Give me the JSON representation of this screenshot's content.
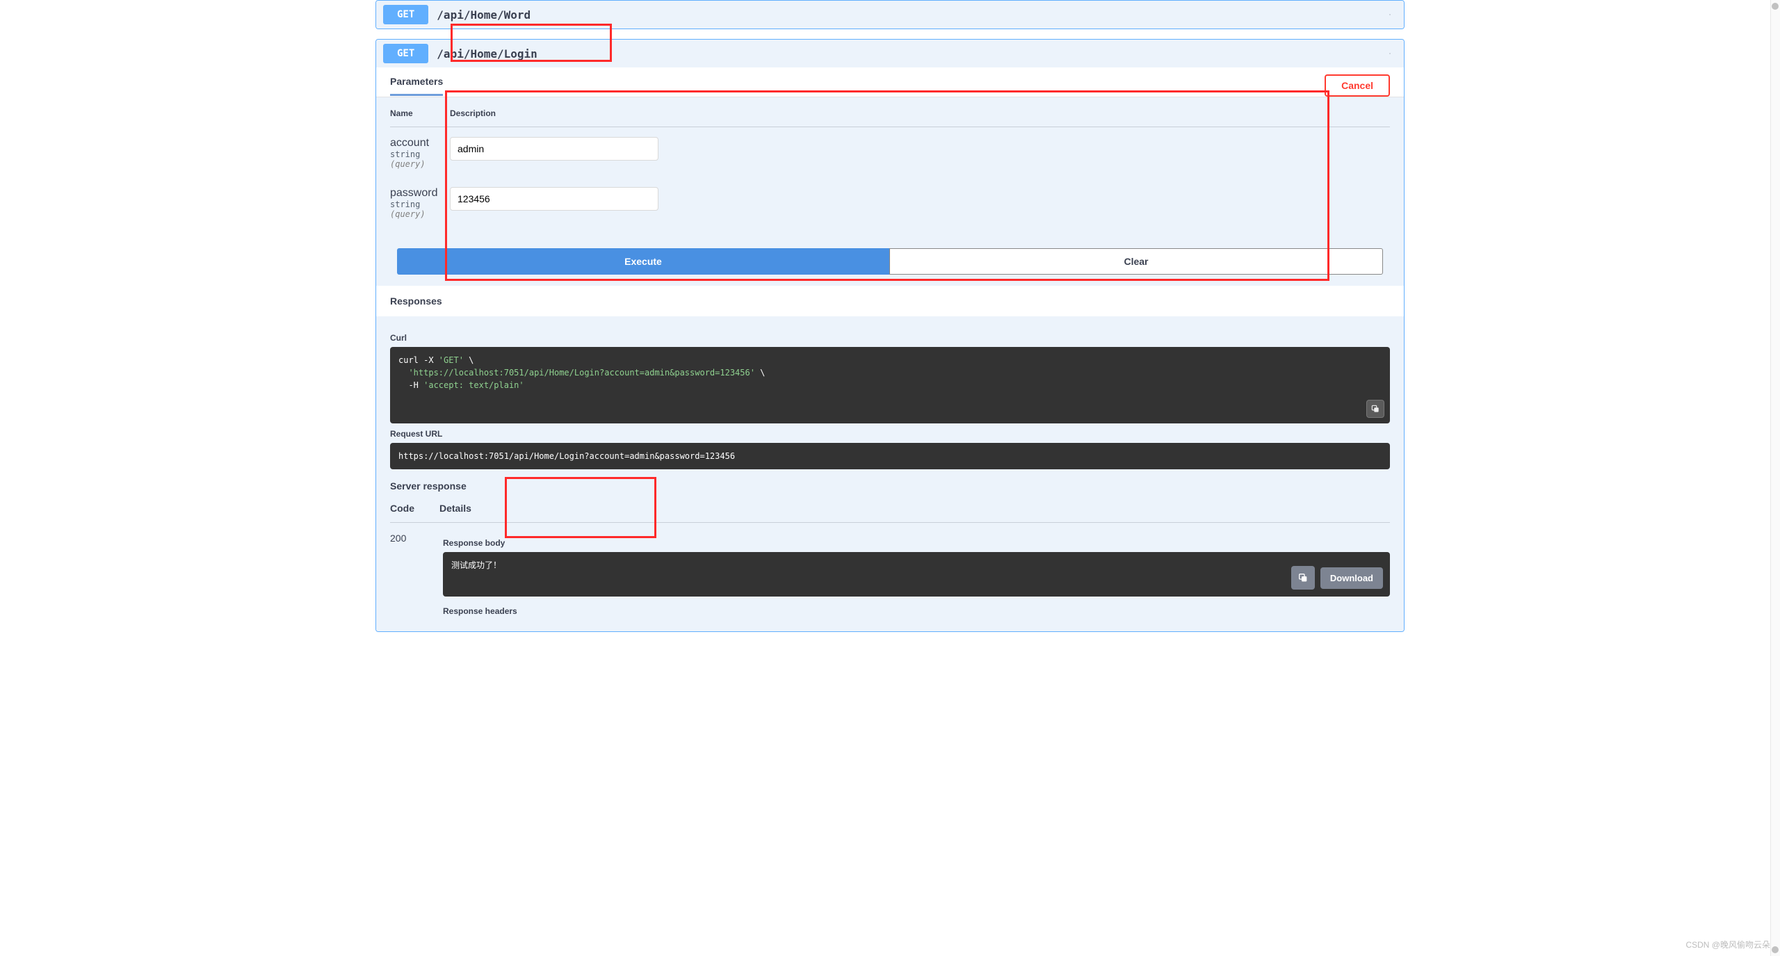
{
  "endpoints": {
    "word": {
      "method": "GET",
      "path": "/api/Home/Word"
    },
    "login": {
      "method": "GET",
      "path": "/api/Home/Login"
    }
  },
  "parameters_section": {
    "tab": "Parameters",
    "cancel": "Cancel",
    "columns": {
      "name": "Name",
      "description": "Description"
    },
    "rows": [
      {
        "name": "account",
        "type": "string",
        "in": "(query)",
        "value": "admin"
      },
      {
        "name": "password",
        "type": "string",
        "in": "(query)",
        "value": "123456"
      }
    ],
    "execute": "Execute",
    "clear": "Clear"
  },
  "responses_section": {
    "title": "Responses",
    "curl": {
      "label": "Curl",
      "line1_a": "curl -X ",
      "line1_b": "'GET'",
      "line1_c": " \\",
      "line2_a": "  ",
      "line2_b": "'https://localhost:7051/api/Home/Login?account=admin&password=123456'",
      "line2_c": " \\",
      "line3_a": "  -H ",
      "line3_b": "'accept: text/plain'"
    },
    "request_url": {
      "label": "Request URL",
      "value": "https://localhost:7051/api/Home/Login?account=admin&password=123456"
    },
    "server_response": {
      "label": "Server response",
      "columns": {
        "code": "Code",
        "details": "Details"
      },
      "code": "200",
      "body_label": "Response body",
      "body_value": "测试成功了！",
      "headers_label": "Response headers",
      "download": "Download"
    }
  },
  "watermark": "CSDN @晚风偷吻云朵"
}
